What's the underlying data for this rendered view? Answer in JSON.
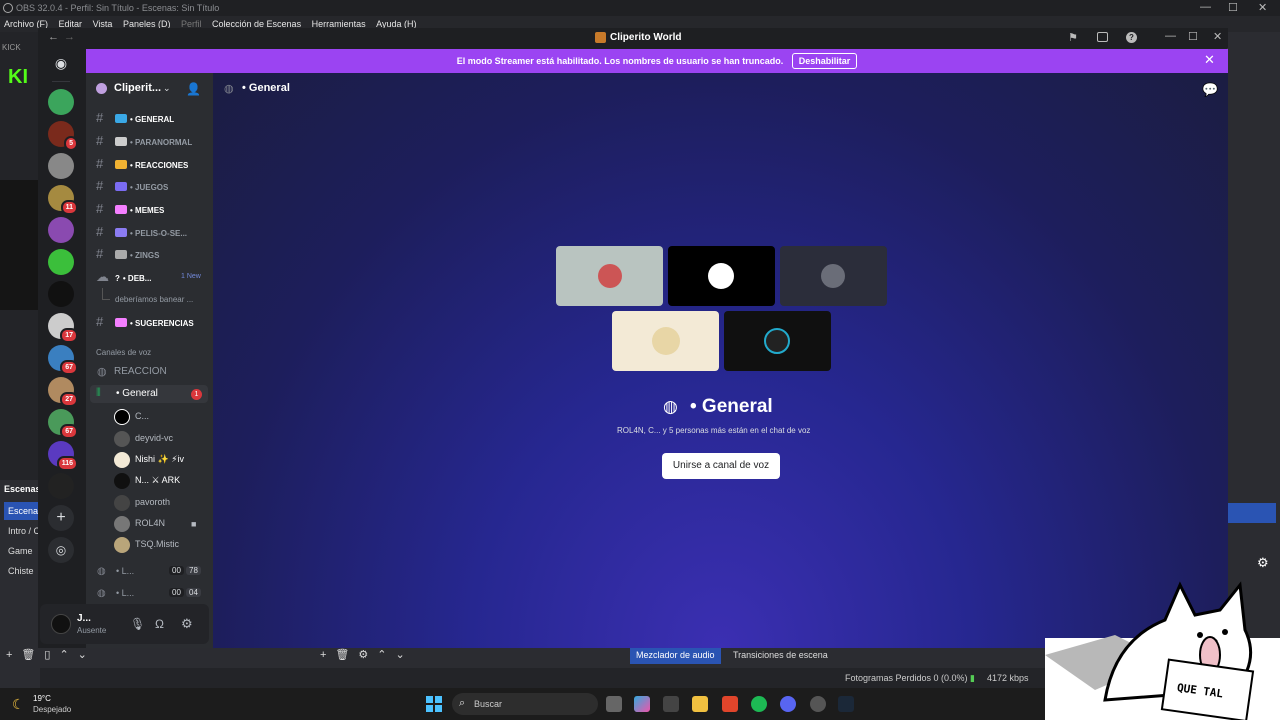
{
  "obs": {
    "title": "OBS 32.0.4 - Perfil: Sin Título - Escenas: Sin Título",
    "menu": [
      "Archivo (F)",
      "Editar",
      "Vista",
      "Paneles (D)",
      "Perfil",
      "Colección de Escenas",
      "Herramientas",
      "Ayuda (H)"
    ],
    "kick_label": "KICK",
    "scenes_header": "Escenas",
    "scenes": [
      "Escena",
      "Intro / C",
      "Game",
      "Chiste"
    ],
    "tabs": [
      "Mezclador de audio",
      "Transiciones de escena"
    ],
    "status_dropped": "Fotogramas Perdidos 0 (0.0%)",
    "status_kbps": "4172 kbps"
  },
  "taskbar": {
    "temp": "19°C",
    "weather": "Despejado",
    "search_placeholder": "Buscar"
  },
  "discord": {
    "window_title": "Cliperito World",
    "banner_text": "El modo Streamer está habilitado. Los nombres de usuario se han truncado.",
    "banner_button": "Deshabilitar",
    "guild_name": "Cliperit...",
    "server_badges": [
      "5",
      "11",
      "17",
      "67",
      "27",
      "67",
      "116"
    ],
    "text_channels": [
      {
        "name": "• GENERAL",
        "unread": true,
        "color": "#3aa8e6"
      },
      {
        "name": "• PARANORMAL",
        "unread": false,
        "color": "#cccccc"
      },
      {
        "name": "• REACCIONES",
        "unread": true,
        "color": "#f0b232"
      },
      {
        "name": "• JUEGOS",
        "unread": false,
        "color": "#7b6cf2"
      },
      {
        "name": "• MEMES",
        "unread": true,
        "color": "#f47fff"
      },
      {
        "name": "• PELIS-O-SE...",
        "unread": false,
        "color": "#8b7cf2"
      },
      {
        "name": "• ZINGS",
        "unread": false,
        "color": "#aaaaaa"
      },
      {
        "name": "• DEB...",
        "unread": true,
        "color": "#ffffff",
        "badge": "1 New"
      },
      {
        "name": "• SUGERENCIAS",
        "unread": true,
        "color": "#f47fff"
      }
    ],
    "thread": "deberíamos banear ...",
    "voice_category": "Canales de voz",
    "voice_reaccion": "REACCION",
    "voice_general": "• General",
    "voice_general_badge": "1",
    "voice_users": [
      "C...",
      "deyvid-vc",
      "Nishi ✨ ⚡iv",
      "N... ⚔ ARK",
      "pavoroth",
      "ROL4N",
      "TSQ.Mistic"
    ],
    "voice_extra": [
      {
        "name": "• L...",
        "t1": "00",
        "t2": "78"
      },
      {
        "name": "• L...",
        "t1": "00",
        "t2": "04"
      }
    ],
    "user_name": "J...",
    "user_status": "Ausente",
    "channel_header": "• General",
    "vc_title": "• General",
    "vc_subtitle": "ROL4N, C... y 5 personas más están en el chat de voz",
    "join_button": "Unirse a canal de voz",
    "tile_colors": [
      "#b9c4c0",
      "#000000",
      "#2b2d3a",
      "#f3ead6",
      "#101010"
    ]
  },
  "overlay": {
    "sticker_text": "QUE TAL"
  }
}
